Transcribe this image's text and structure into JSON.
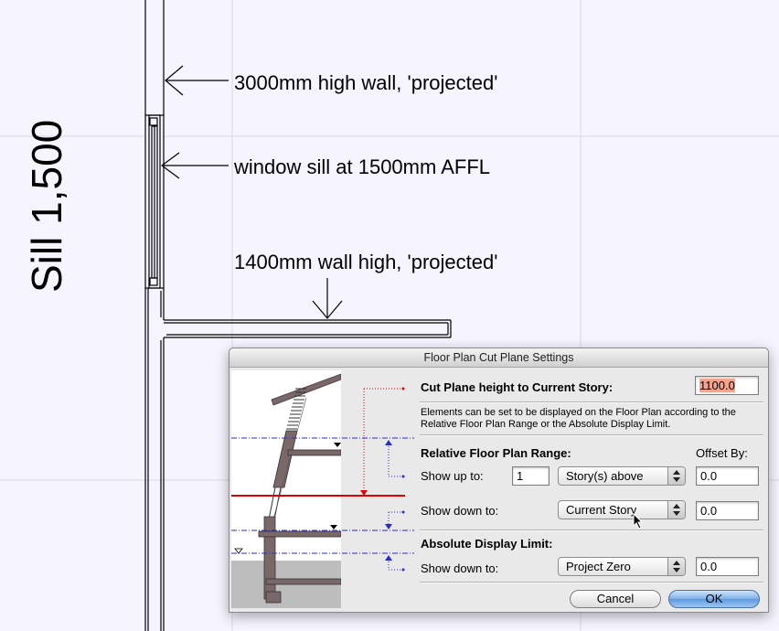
{
  "drawing": {
    "sill_label": "Sill 1,500",
    "annotations": {
      "wall_3000": "3000mm high wall, 'projected'",
      "window_sill": "window sill at 1500mm AFFL",
      "wall_1400": "1400mm wall high, 'projected'"
    }
  },
  "dialog": {
    "title": "Floor Plan Cut Plane Settings",
    "cut_plane_label": "Cut Plane height to Current Story:",
    "cut_plane_value": "1100.0",
    "description": "Elements can be set to be displayed on the Floor Plan according to the Relative Floor Plan Range or the Absolute Display Limit.",
    "relative_range_title": "Relative Floor Plan Range:",
    "offset_by_label": "Offset By:",
    "show_up_to": {
      "label": "Show up to:",
      "count": "1",
      "option": "Story(s) above",
      "offset": "0.0"
    },
    "show_down_to_relative": {
      "label": "Show down to:",
      "option": "Current Story",
      "offset": "0.0"
    },
    "absolute_limit_title": "Absolute Display Limit:",
    "show_down_to_absolute": {
      "label": "Show down to:",
      "option": "Project Zero",
      "offset": "0.0"
    },
    "cancel_label": "Cancel",
    "ok_label": "OK"
  },
  "colors": {
    "canvas_bg": "#f6f4fe",
    "cut_line": "#e00000",
    "level_line": "#2a2ad0",
    "wall_fill": "#7a6868",
    "highlight": "#f5a48e"
  }
}
